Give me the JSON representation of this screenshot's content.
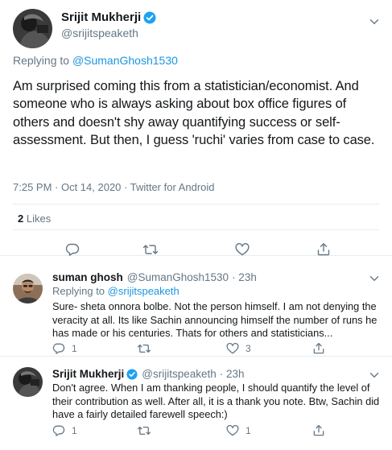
{
  "main_tweet": {
    "author_name": "Srijit Mukherji",
    "author_handle": "@srijitspeaketh",
    "replying_prefix": "Replying to",
    "replying_to": "@SumanGhosh1530",
    "text": "Am surprised coming this from a statistician/economist. And someone who is always asking about box office figures of others and doesn't shy away quantifying success or self-assessment. But then, I guess 'ruchi' varies from case to case.",
    "meta": "7:25 PM · Oct 14, 2020 · Twitter for Android",
    "likes_count": "2",
    "likes_label": "Likes"
  },
  "replies": [
    {
      "author_name": "suman ghosh",
      "author_handle": "@SumanGhosh1530",
      "time": "· 23h",
      "replying_prefix": "Replying to",
      "replying_to": "@srijitspeaketh",
      "text": "Sure- sheta onnora bolbe. Not the person himself. I am not denying the veracity at all. Its like Sachin announcing himself the number of runs he has made or his centuries. Thats for others and statisticians...",
      "reply_count": "1",
      "retweet_count": "",
      "like_count": "3"
    },
    {
      "author_name": "Srijit Mukherji",
      "author_handle": "@srijitspeaketh",
      "time": "· 23h",
      "text": "Don't agree. When I am thanking people, I should quantify the level of their contribution as well. After all, it is a thank you note. Btw, Sachin did have a fairly detailed farewell speech:)",
      "reply_count": "1",
      "retweet_count": "",
      "like_count": "1"
    }
  ],
  "colors": {
    "accent": "#1da1f2",
    "link": "#1b95e0",
    "muted": "#657786",
    "text": "#14171a",
    "border": "#e6ecf0"
  },
  "icons": [
    "verified-badge-icon",
    "chevron-down-icon",
    "reply-icon",
    "retweet-icon",
    "like-icon",
    "share-icon"
  ]
}
